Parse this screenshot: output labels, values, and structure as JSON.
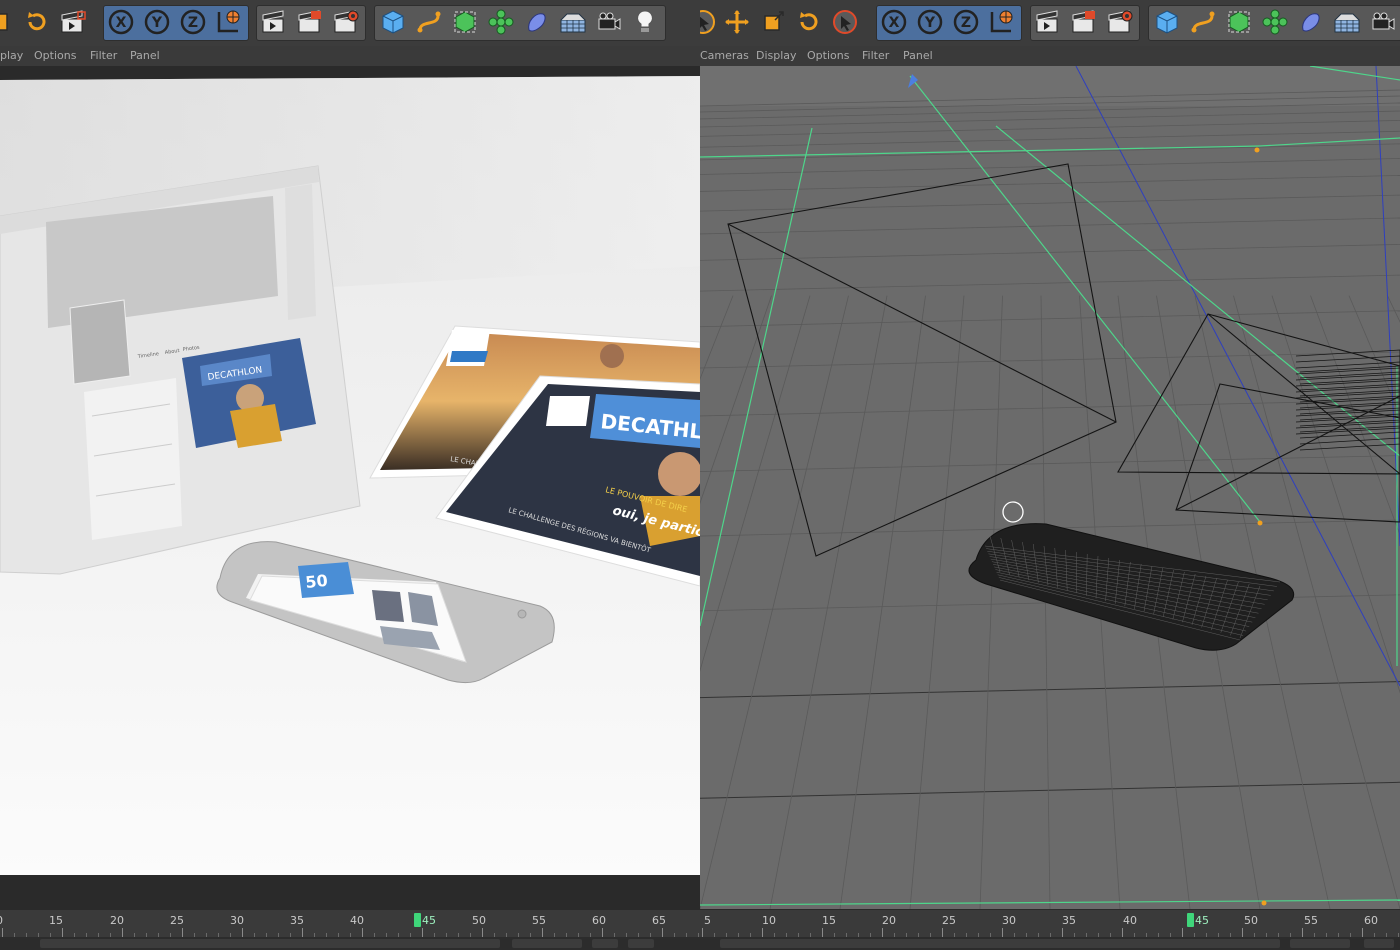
{
  "left_pane": {
    "menu": [
      "play",
      "Options",
      "Filter",
      "Panel"
    ],
    "ruler_labels": [
      "0",
      "15",
      "20",
      "25",
      "30",
      "35",
      "40",
      "50",
      "55",
      "60",
      "65"
    ],
    "current_frame": "45"
  },
  "right_pane": {
    "menu": [
      "Cameras",
      "Display",
      "Options",
      "Filter",
      "Panel"
    ],
    "ruler_labels": [
      "5",
      "10",
      "15",
      "20",
      "25",
      "30",
      "35",
      "40",
      "50",
      "55",
      "60"
    ],
    "current_frame": "45"
  },
  "render_scene": {
    "brand_text": "DECATHLON",
    "poster_text_1": "LE POUVOIR DE DIRE",
    "poster_text_2": "oui, je participe",
    "poster_text_3": "LE CHALLENGE DES RÉGIONS VA BIENTÔT",
    "phone_badge": "50",
    "profile_label_1": "Timeline",
    "profile_label_2": "About",
    "profile_label_3": "Photos"
  },
  "colors": {
    "toolbar_bg": "#3c3c3c",
    "tool_group_blue": "#4c6f9e",
    "playhead": "#3fd67a",
    "camera_line": "#4ed68b",
    "axis_blue": "#2e3fbf",
    "grid_floor": "#6d6d6d"
  },
  "toolbar_icons": [
    "cube-icon",
    "refresh-icon",
    "clapper-icon",
    "x-axis-icon",
    "y-axis-icon",
    "z-axis-icon",
    "world-axis-icon",
    "render-view-icon",
    "render-picture-icon",
    "render-settings-icon",
    "cube-primitive-icon",
    "spline-icon",
    "nurbs-icon",
    "array-icon",
    "deformer-icon",
    "scene-floor-icon",
    "camera-icon",
    "light-icon"
  ]
}
